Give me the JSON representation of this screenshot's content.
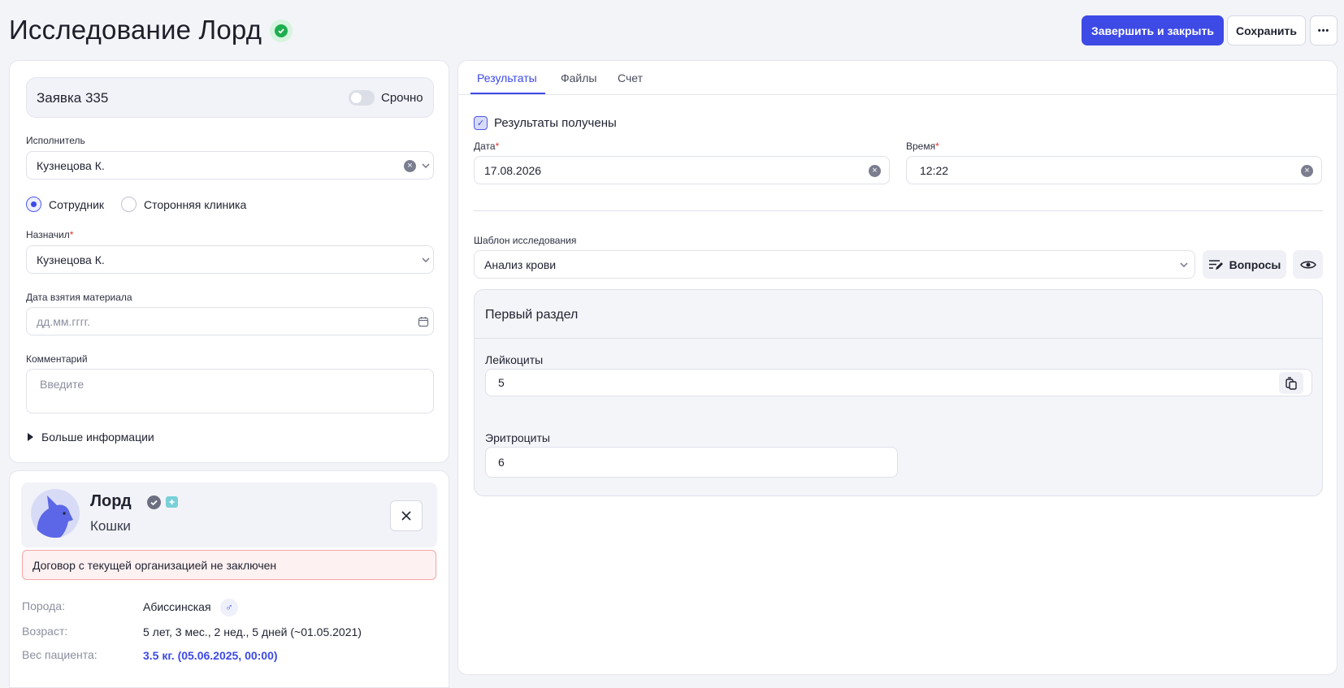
{
  "header": {
    "title": "Исследование Лорд",
    "finish_label": "Завершить и закрыть",
    "save_label": "Сохранить",
    "more_label": "•••"
  },
  "order": {
    "title": "Заявка 335",
    "urgent_label": "Срочно",
    "urgent_on": false
  },
  "executor": {
    "label": "Исполнитель",
    "value": "Кузнецова К.",
    "options": [
      "Сотрудник",
      "Сторонняя клиника"
    ],
    "selected": "Сотрудник"
  },
  "assigned": {
    "label": "Назначил",
    "required_mark": "*",
    "value": "Кузнецова К."
  },
  "material_date": {
    "label": "Дата взятия материала",
    "placeholder": "дд.мм.гггг."
  },
  "comment": {
    "label": "Комментарий",
    "placeholder": "Введите"
  },
  "more_info_label": "Больше информации",
  "patient": {
    "name": "Лорд",
    "species": "Кошки",
    "alert": "Договор с текущей организацией не заключен",
    "breed_label": "Порода:",
    "breed": "Абиссинская",
    "sex_symbol": "♂",
    "age_label": "Возраст:",
    "age": "5 лет, 3 мес., 2 нед., 5 дней (~01.05.2021)",
    "weight_label": "Вес пациента:",
    "weight": "3.5 кг. (05.06.2025, 00:00)"
  },
  "tabs": [
    "Результаты",
    "Файлы",
    "Счет"
  ],
  "results": {
    "received_label": "Результаты получены",
    "received": true,
    "date_label": "Дата",
    "date_value": "17.08.2026",
    "time_label": "Время",
    "time_value": "12:22",
    "required_mark": "*",
    "template_label": "Шаблон исследования",
    "template_value": "Анализ крови",
    "questions_label": "Вопросы",
    "section_title": "Первый раздел",
    "leukocytes_label": "Лейкоциты",
    "leukocytes_value": "5",
    "erythrocytes_label": "Эритроциты",
    "erythrocytes_value": "6"
  },
  "colors": {
    "accent": "#3d4ae6",
    "success": "#1dae4f",
    "alert_bg": "#fdf1f1",
    "alert_border": "#f1a6a6"
  }
}
